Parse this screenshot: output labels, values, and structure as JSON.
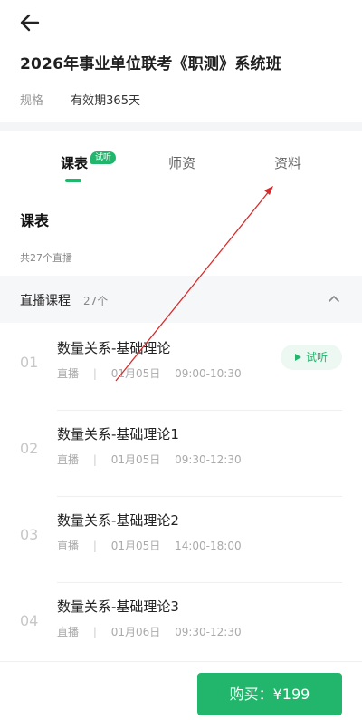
{
  "header": {
    "back_icon": "arrow-left-icon"
  },
  "product": {
    "title": "2026年事业单位联考《职测》系统班",
    "spec_label": "规格",
    "spec_value": "有效期365天"
  },
  "tabs": [
    {
      "label": "课表",
      "active": true,
      "badge": "试听"
    },
    {
      "label": "师资",
      "active": false
    },
    {
      "label": "资料",
      "active": false
    }
  ],
  "schedule": {
    "title": "课表",
    "total": "共27个直播",
    "group_label": "直播课程",
    "group_count": "27个",
    "lessons": [
      {
        "num": "01",
        "name": "数量关系-基础理论",
        "type": "直播",
        "sep": "|",
        "date": "01月05日",
        "time": "09:00-10:30",
        "trial": "试听"
      },
      {
        "num": "02",
        "name": "数量关系-基础理论1",
        "type": "直播",
        "sep": "|",
        "date": "01月05日",
        "time": "09:30-12:30"
      },
      {
        "num": "03",
        "name": "数量关系-基础理论2",
        "type": "直播",
        "sep": "|",
        "date": "01月05日",
        "time": "14:00-18:00"
      },
      {
        "num": "04",
        "name": "数量关系-基础理论3",
        "type": "直播",
        "sep": "|",
        "date": "01月06日",
        "time": "09:30-12:30"
      }
    ]
  },
  "footer": {
    "buy_label": "购买：¥199"
  },
  "colors": {
    "accent": "#21b66c",
    "annotation_arrow": "#d62b2b"
  }
}
